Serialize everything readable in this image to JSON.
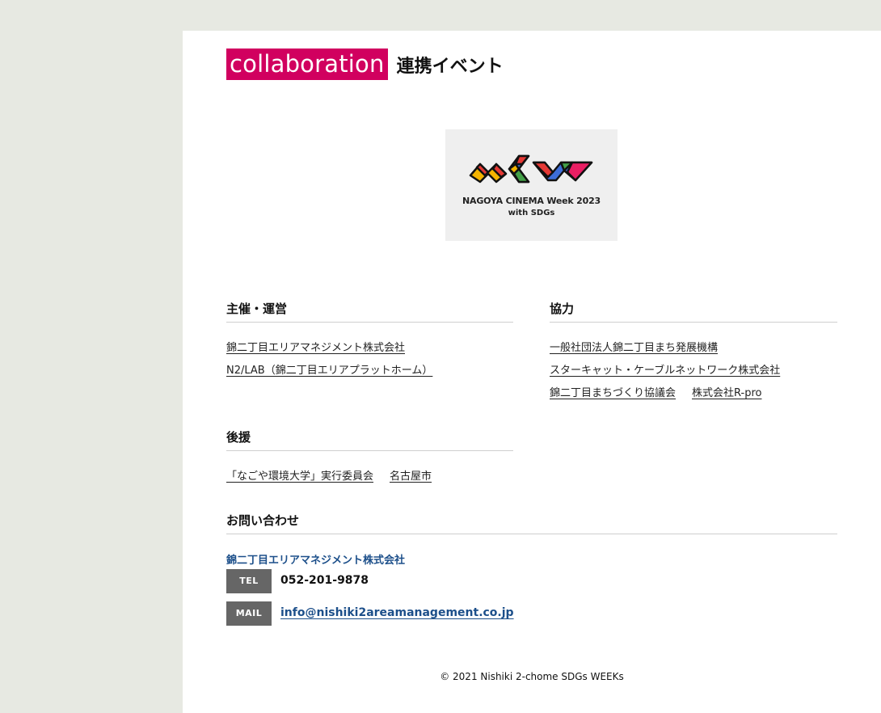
{
  "header": {
    "title_en": "collaboration",
    "title_jp": "連携イベント"
  },
  "logo": {
    "line1": "NAGOYA CINEMA Week 2023",
    "line2": "with SDGs"
  },
  "organizers": {
    "title": "主催・運営",
    "links": [
      "錦二丁目エリアマネジメント株式会社",
      "N2/LAB（錦二丁目エリアプラットホーム）"
    ]
  },
  "cooperation": {
    "title": "協力",
    "links": [
      "一般社団法人錦二丁目まち発展機構",
      "スターキャット・ケーブルネットワーク株式会社"
    ],
    "last_row": [
      "錦二丁目まちづくり協議会",
      "株式会社R-pro"
    ]
  },
  "support": {
    "title": "後援",
    "links": [
      "「なごや環境大学」実行委員会",
      "名古屋市"
    ]
  },
  "contact": {
    "title": "お問い合わせ",
    "org": "錦二丁目エリアマネジメント株式会社",
    "tel_label": "TEL",
    "tel": "052-201-9878",
    "mail_label": "MAIL",
    "mail": "info@nishiki2areamanagement.co.jp"
  },
  "footer": {
    "copyright": "© 2021 Nishiki 2-chome SDGs WEEKs"
  },
  "colors": {
    "accent": "#d1005f",
    "link_blue": "#1c4f8a",
    "background": "#e7e9e2",
    "badge": "#666666"
  }
}
